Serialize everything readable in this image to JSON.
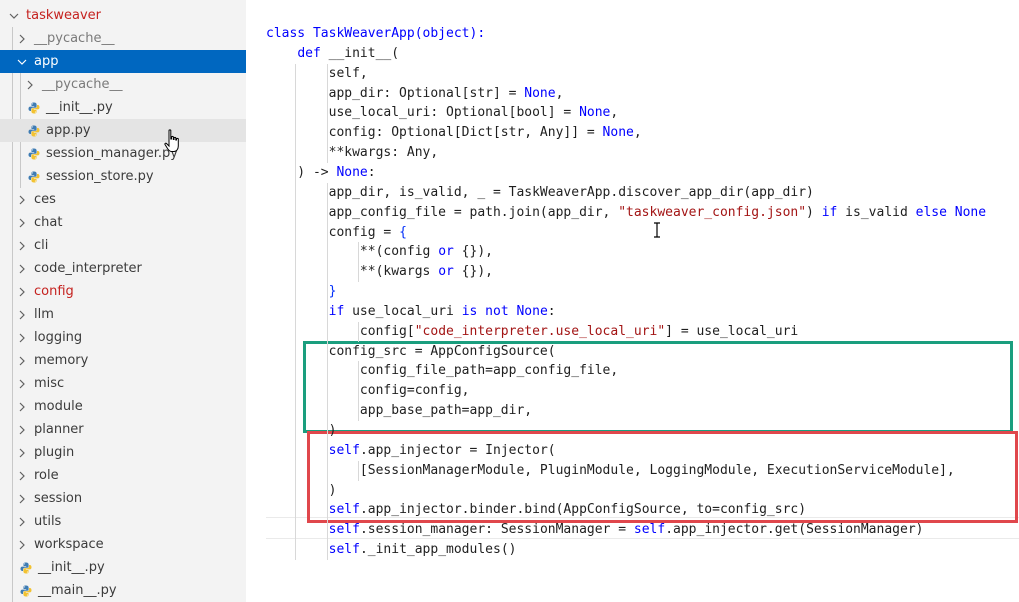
{
  "explorer": {
    "items": [
      {
        "label": "taskweaver",
        "kind": "folder-open",
        "depth": 0,
        "modified": true
      },
      {
        "label": "__pycache__",
        "kind": "folder",
        "depth": 1,
        "muted": true
      },
      {
        "label": "app",
        "kind": "folder-open",
        "depth": 1,
        "selected": true
      },
      {
        "label": "__pycache__",
        "kind": "folder",
        "depth": 2,
        "muted": true
      },
      {
        "label": "__init__.py",
        "kind": "file",
        "depth": 2
      },
      {
        "label": "app.py",
        "kind": "file",
        "depth": 2,
        "hover": true
      },
      {
        "label": "session_manager.py",
        "kind": "file",
        "depth": 2
      },
      {
        "label": "session_store.py",
        "kind": "file",
        "depth": 2
      },
      {
        "label": "ces",
        "kind": "folder",
        "depth": 1
      },
      {
        "label": "chat",
        "kind": "folder",
        "depth": 1
      },
      {
        "label": "cli",
        "kind": "folder",
        "depth": 1
      },
      {
        "label": "code_interpreter",
        "kind": "folder",
        "depth": 1
      },
      {
        "label": "config",
        "kind": "folder",
        "depth": 1,
        "modified": true
      },
      {
        "label": "llm",
        "kind": "folder",
        "depth": 1
      },
      {
        "label": "logging",
        "kind": "folder",
        "depth": 1
      },
      {
        "label": "memory",
        "kind": "folder",
        "depth": 1
      },
      {
        "label": "misc",
        "kind": "folder",
        "depth": 1
      },
      {
        "label": "module",
        "kind": "folder",
        "depth": 1
      },
      {
        "label": "planner",
        "kind": "folder",
        "depth": 1
      },
      {
        "label": "plugin",
        "kind": "folder",
        "depth": 1
      },
      {
        "label": "role",
        "kind": "folder",
        "depth": 1
      },
      {
        "label": "session",
        "kind": "folder",
        "depth": 1
      },
      {
        "label": "utils",
        "kind": "folder",
        "depth": 1
      },
      {
        "label": "workspace",
        "kind": "folder",
        "depth": 1
      },
      {
        "label": "__init__.py",
        "kind": "file",
        "depth": 1
      },
      {
        "label": "__main__.py",
        "kind": "file",
        "depth": 1
      }
    ]
  },
  "editor": {
    "lines": [
      [
        [
          "class TaskWeaverApp(object):",
          "k"
        ]
      ],
      [
        [
          "    ",
          ""
        ],
        [
          "def",
          "k"
        ],
        [
          " __init__(",
          ""
        ]
      ],
      [
        [
          "        self,",
          ""
        ]
      ],
      [
        [
          "        app_dir: Optional[str] = ",
          ""
        ],
        [
          "None",
          "k"
        ],
        [
          ",",
          ""
        ]
      ],
      [
        [
          "        use_local_uri: Optional[bool] = ",
          ""
        ],
        [
          "None",
          "k"
        ],
        [
          ",",
          ""
        ]
      ],
      [
        [
          "        config: Optional[Dict[str, Any]] = ",
          ""
        ],
        [
          "None",
          "k"
        ],
        [
          ",",
          ""
        ]
      ],
      [
        [
          "        **kwargs: Any,",
          ""
        ]
      ],
      [
        [
          "    ) -> ",
          ""
        ],
        [
          "None",
          "k"
        ],
        [
          ":",
          ""
        ]
      ],
      [
        [
          "        app_dir, is_valid, _ = TaskWeaverApp.discover_app_dir(app_dir)",
          ""
        ]
      ],
      [
        [
          "        app_config_file = path.join(app_dir, ",
          ""
        ],
        [
          "\"taskweaver_config.json\"",
          "s"
        ],
        [
          ") ",
          ""
        ],
        [
          "if",
          "k"
        ],
        [
          " is_valid ",
          ""
        ],
        [
          "else",
          "k"
        ],
        [
          " ",
          ""
        ],
        [
          "None",
          "k"
        ]
      ],
      [
        [
          "        config = ",
          ""
        ],
        [
          "{",
          "b"
        ]
      ],
      [
        [
          "            **(config ",
          ""
        ],
        [
          "or",
          "k"
        ],
        [
          " {}),",
          ""
        ]
      ],
      [
        [
          "            **(kwargs ",
          ""
        ],
        [
          "or",
          "k"
        ],
        [
          " {}),",
          ""
        ]
      ],
      [
        [
          "        ",
          ""
        ],
        [
          "}",
          "b"
        ]
      ],
      [
        [
          "        ",
          ""
        ],
        [
          "if",
          "k"
        ],
        [
          " use_local_uri ",
          ""
        ],
        [
          "is not",
          "k"
        ],
        [
          " ",
          ""
        ],
        [
          "None",
          "k"
        ],
        [
          ":",
          ""
        ]
      ],
      [
        [
          "            config[",
          ""
        ],
        [
          "\"code_interpreter.use_local_uri\"",
          "s"
        ],
        [
          "] = use_local_uri",
          ""
        ]
      ],
      [
        [
          "        config_src = AppConfigSource(",
          ""
        ]
      ],
      [
        [
          "            config_file_path=app_config_file,",
          ""
        ]
      ],
      [
        [
          "            config=config,",
          ""
        ]
      ],
      [
        [
          "            app_base_path=app_dir,",
          ""
        ]
      ],
      [
        [
          "        )",
          ""
        ]
      ],
      [
        [
          "        ",
          ""
        ],
        [
          "self",
          "k"
        ],
        [
          ".app_injector = Injector(",
          ""
        ]
      ],
      [
        [
          "            [SessionManagerModule, PluginModule, LoggingModule, ExecutionServiceModule],",
          ""
        ]
      ],
      [
        [
          "        )",
          ""
        ]
      ],
      [
        [
          "        ",
          ""
        ],
        [
          "self",
          "k"
        ],
        [
          ".app_injector.binder.bind(AppConfigSource, to=config_src)",
          ""
        ]
      ],
      [
        [
          "        ",
          ""
        ],
        [
          "self",
          "k"
        ],
        [
          ".session_manager: SessionManager = ",
          ""
        ],
        [
          "self",
          "k"
        ],
        [
          ".app_injector.get(SessionManager)",
          ""
        ]
      ],
      [
        [
          "        ",
          ""
        ],
        [
          "self",
          "k"
        ],
        [
          "._init_app_modules()",
          ""
        ]
      ]
    ]
  },
  "highlights": {
    "green_box_color": "#1a9e7e",
    "red_box_color": "#e0474c"
  },
  "colors": {
    "keyword": "#0000ff",
    "string": "#a31515",
    "selection": "#0067c0"
  }
}
